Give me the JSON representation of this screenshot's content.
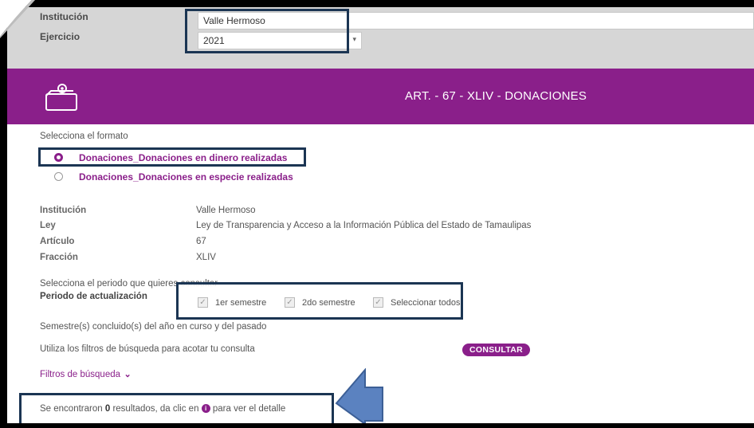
{
  "top": {
    "institucion_label": "Institución",
    "institucion_value": "Valle Hermoso",
    "ejercicio_label": "Ejercicio",
    "ejercicio_value": "2021"
  },
  "header": {
    "title": "ART. - 67 - XLIV - DONACIONES"
  },
  "format": {
    "prompt": "Selecciona el formato",
    "options": [
      {
        "label": "Donaciones_Donaciones en dinero realizadas",
        "selected": true
      },
      {
        "label": "Donaciones_Donaciones en especie realizadas",
        "selected": false
      }
    ]
  },
  "details": {
    "rows": [
      {
        "label": "Institución",
        "value": "Valle Hermoso"
      },
      {
        "label": "Ley",
        "value": "Ley de Transparencia y Acceso a la Información Pública del Estado de Tamaulipas"
      },
      {
        "label": "Artículo",
        "value": "67"
      },
      {
        "label": "Fracción",
        "value": "XLIV"
      }
    ]
  },
  "period": {
    "prompt": "Selecciona el periodo que quieres consultar",
    "label": "Periodo de actualización",
    "options": [
      "1er semestre",
      "2do semestre",
      "Seleccionar todos"
    ],
    "note": "Semestre(s) concluido(s) del año en curso y del pasado"
  },
  "search": {
    "hint": "Utiliza los filtros de búsqueda para acotar tu consulta",
    "button": "CONSULTAR",
    "filters_label": "Filtros de búsqueda"
  },
  "results": {
    "prefix": "Se encontraron ",
    "count": "0",
    "middle": " resultados, da clic en ",
    "suffix": " para ver el detalle"
  },
  "colors": {
    "accent": "#8a1f8a",
    "highlight_border": "#1b3553",
    "arrow": "#5b82c0"
  }
}
